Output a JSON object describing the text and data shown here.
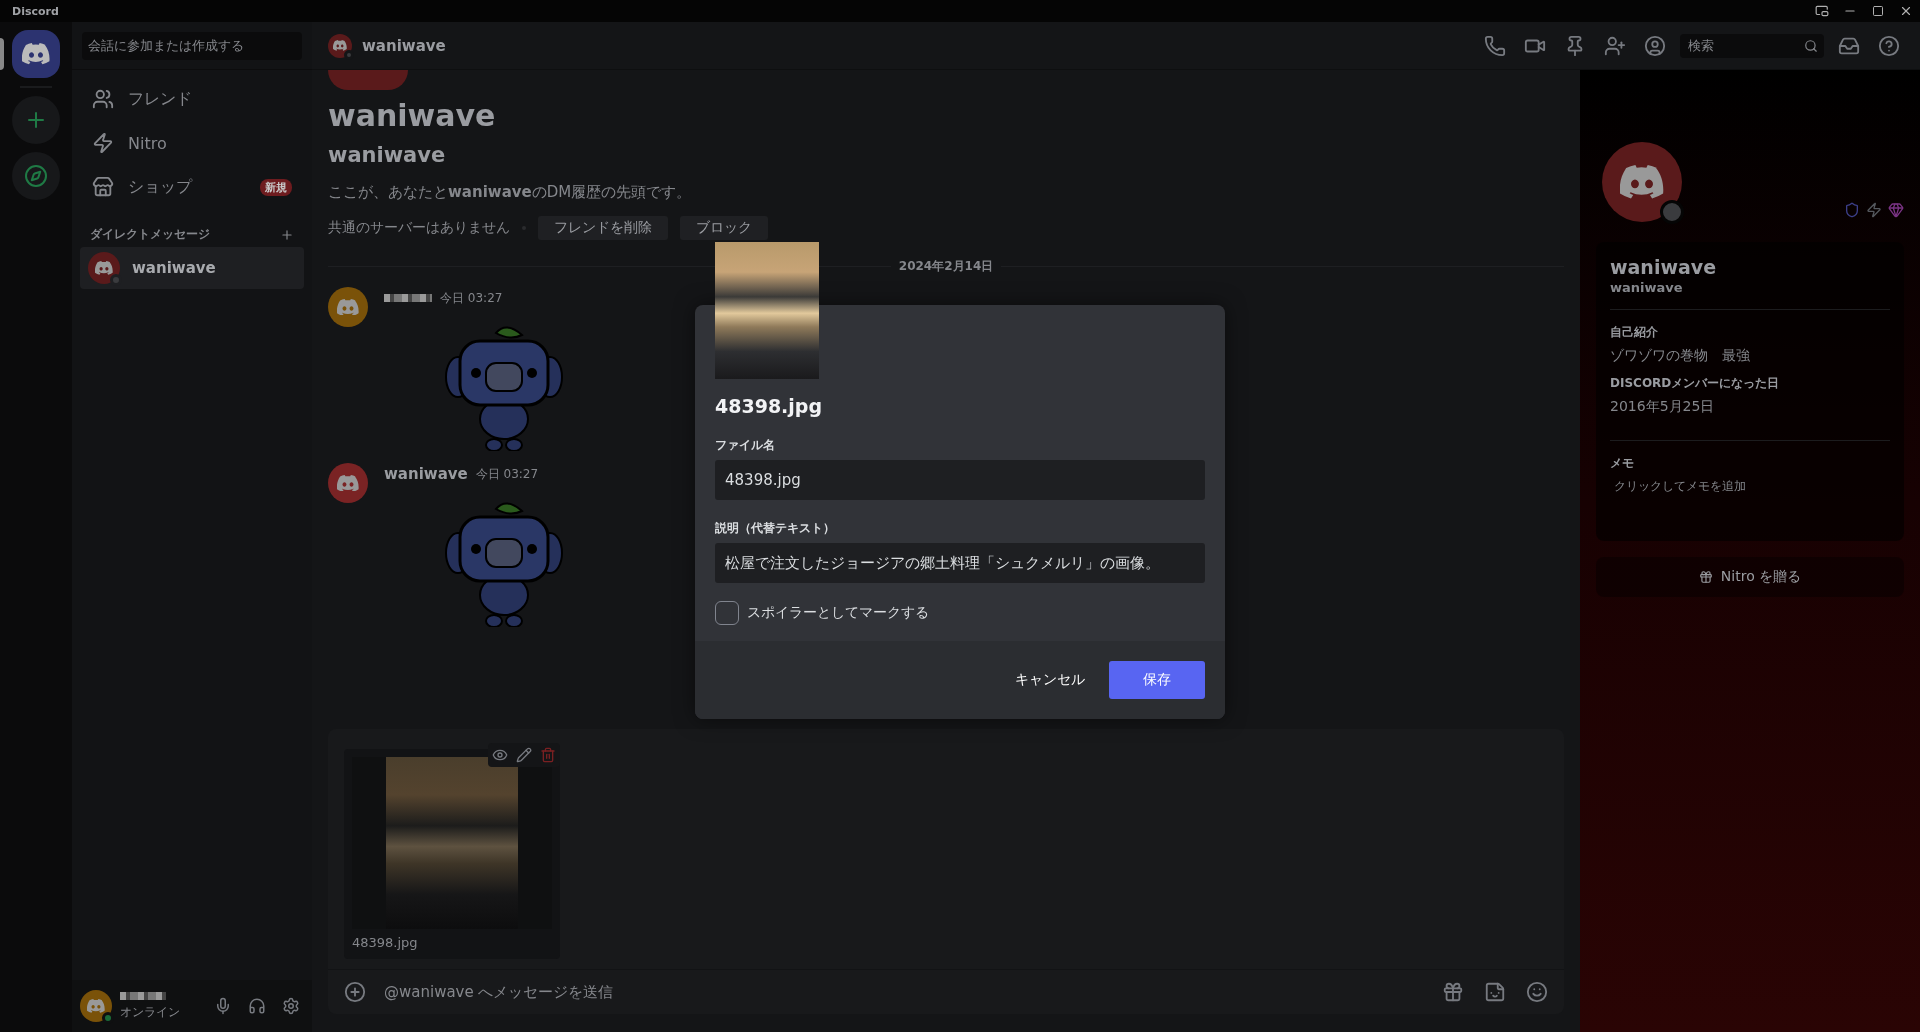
{
  "app": {
    "title": "Discord"
  },
  "servers": [
    {
      "kind": "home",
      "selected": true
    },
    {
      "kind": "add",
      "selected": false
    },
    {
      "kind": "explore",
      "selected": false
    }
  ],
  "sidebar": {
    "search_placeholder": "会話に参加または作成する",
    "nav": [
      {
        "kind": "friends",
        "label": "フレンド"
      },
      {
        "kind": "nitro",
        "label": "Nitro"
      },
      {
        "kind": "shop",
        "label": "ショップ",
        "badge": "新規"
      }
    ],
    "dm_header": "ダイレクトメッセージ",
    "dms": [
      {
        "name": "waniwave",
        "selected": true
      }
    ]
  },
  "user": {
    "status": "オンライン"
  },
  "header": {
    "name": "waniwave",
    "search_placeholder": "検索"
  },
  "intro": {
    "display_name": "waniwave",
    "username": "waniwave",
    "text": "ここが、あなたと**waniwave**のDM履歴の先頭です。",
    "mutual": "共通のサーバーはありません",
    "buttons": [
      "フレンドを削除",
      "ブロック"
    ]
  },
  "date_divider": "2024年2月14日",
  "messages": [
    {
      "kind": "redacted",
      "time": "今日 03:27",
      "color": "#7a5209"
    },
    {
      "kind": "named",
      "author": "waniwave",
      "time": "今日 03:27",
      "color": "#7a2324"
    }
  ],
  "upload": {
    "filename": "48398.jpg"
  },
  "composer": {
    "placeholder": "@waniwave へメッセージを送信"
  },
  "profile": {
    "display_name": "waniwave",
    "username": "waniwave",
    "sections": [
      {
        "title": "自己紹介",
        "text": "ゾワゾワの巻物　最強"
      },
      {
        "title": "DISCORDメンバーになった日",
        "text": "2016年5月25日"
      }
    ],
    "note_title": "メモ",
    "note_placeholder": "クリックしてメモを追加",
    "gift": "Nitro を贈る"
  },
  "modal": {
    "title": "48398.jpg",
    "fields": [
      {
        "label": "ファイル名",
        "value": "48398.jpg"
      },
      {
        "label": "説明（代替テキスト）",
        "value": "松屋で注文したジョージアの郷土料理「シュクメルリ」の画像。"
      }
    ],
    "spoiler": {
      "label": "スポイラーとしてマークする",
      "checked": false
    },
    "cancel": "キャンセル",
    "save": "保存"
  }
}
